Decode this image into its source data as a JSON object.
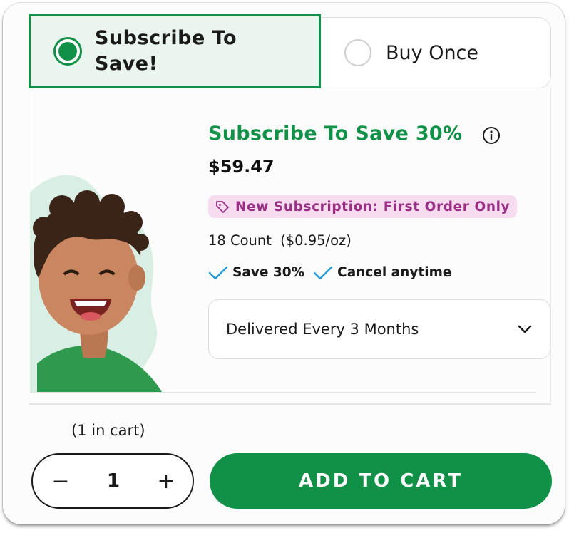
{
  "tabs": {
    "subscribe_label_line1": "Subscribe To",
    "subscribe_label_line2": "Save!",
    "buy_once_label": "Buy Once"
  },
  "product": {
    "title": "Subscribe To Save 30%",
    "price": "$59.47",
    "badge": "New Subscription: First Order Only",
    "count": "18 Count",
    "unit_price": "($0.95/oz)",
    "perks": [
      "Save 30%",
      "Cancel anytime"
    ],
    "delivery_select": "Delivered Every 3 Months"
  },
  "cart": {
    "in_cart_text": "(1 in cart)",
    "quantity": "1",
    "minus_symbol": "−",
    "plus_symbol": "+",
    "add_to_cart_label": "ADD TO CART"
  },
  "icons": {
    "info": "info-icon",
    "tag": "tag-icon",
    "check": "check-icon",
    "chevron": "chevron-down-icon"
  },
  "colors": {
    "brand_green": "#119047",
    "selected_tab_bg": "#e9f5ee",
    "badge_bg": "#f7dcef",
    "badge_text": "#9a2f85",
    "check_blue": "#1e9bd7"
  }
}
